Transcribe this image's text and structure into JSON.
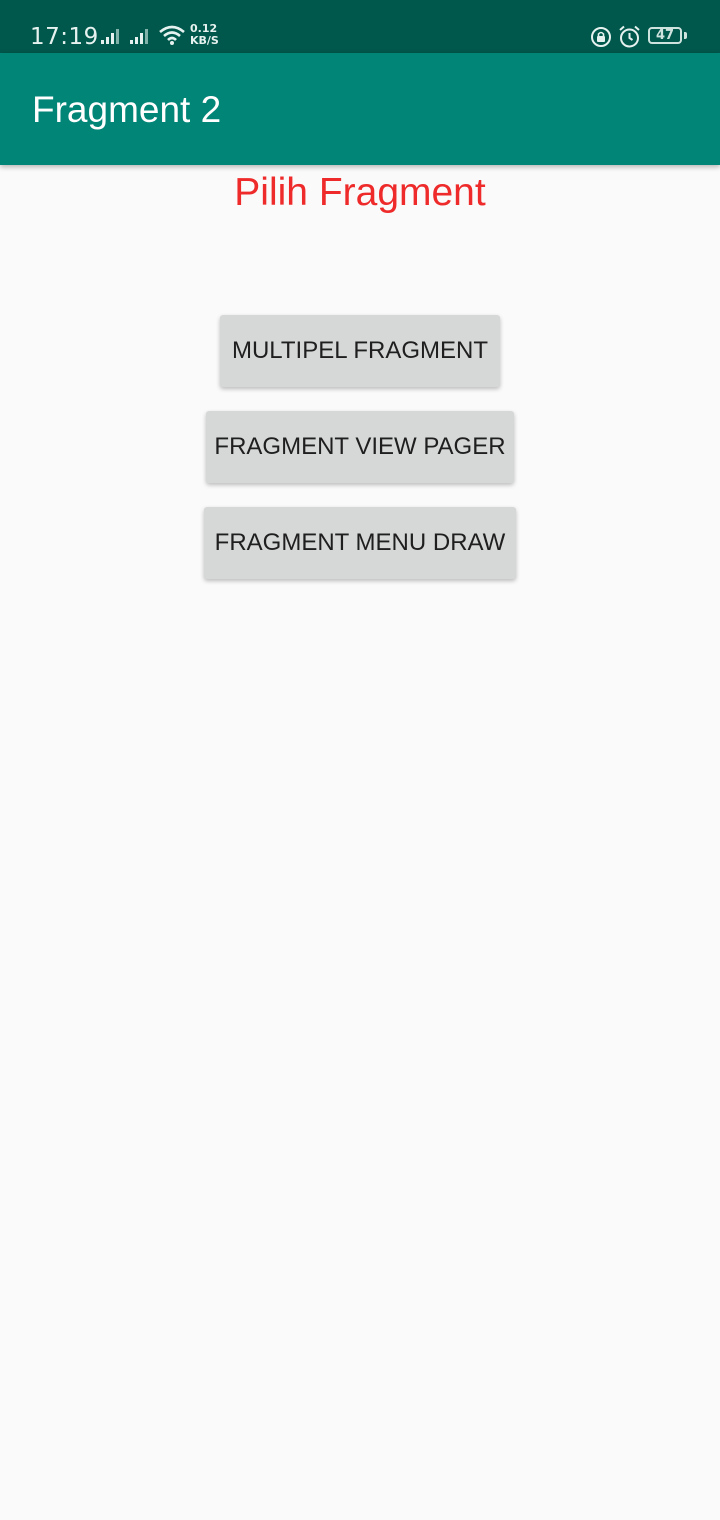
{
  "status_bar": {
    "time": "17:19",
    "net_speed_value": "0.12",
    "net_speed_unit": "KB/S",
    "battery": "47",
    "icons": [
      "signal-icon",
      "signal-icon",
      "wifi-icon",
      "rotation-lock-icon",
      "alarm-icon",
      "battery-icon"
    ]
  },
  "app_bar": {
    "title": "Fragment 2",
    "color": "#008577"
  },
  "main": {
    "heading": "Pilih Fragment",
    "heading_color": "#ee2a2a",
    "buttons": [
      {
        "label": "MULTIPEL FRAGMENT"
      },
      {
        "label": "FRAGMENT VIEW PAGER"
      },
      {
        "label": "FRAGMENT MENU DRAW"
      }
    ]
  }
}
